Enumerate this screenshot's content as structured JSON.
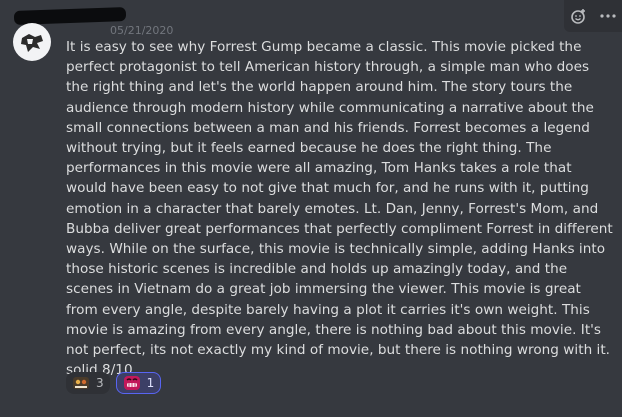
{
  "message": {
    "timestamp": "05/21/2020",
    "content": "It is easy to see why Forrest Gump became a classic. This movie picked the perfect protagonist to tell American history through, a simple man who does the right thing and let's the world happen around him. The story tours the audience through modern history while communicating a narrative about the small connections between a man and his friends. Forrest becomes a legend without trying, but it feels earned because he does the right thing. The performances in this movie were all amazing, Tom Hanks takes a role that would have been easy to not give that much for, and he runs with it, putting emotion in a character that barely emotes. Lt. Dan, Jenny, Forrest's Mom, and Bubba deliver great performances that perfectly compliment Forrest in different ways. While on the surface, this movie is technically simple, adding Hanks into those historic scenes is incredible and holds up amazingly today, and the scenes in Vietnam do a great job immersing the viewer. This movie is great from every angle, despite barely having a plot it carries it's own weight. This movie is amazing from every angle, there is nothing bad about this movie. It's not perfect, its not exactly my kind of movie, but there is nothing wrong with it. solid 8/10"
  },
  "reactions": [
    {
      "icon": "custom-emoji-icon",
      "count": "3"
    },
    {
      "icon": "grin-emoji-icon",
      "count": "1"
    }
  ],
  "toolbar": {
    "add_reaction_icon": "add-reaction-icon",
    "more_icon": "more-options-icon"
  },
  "colors": {
    "background": "#36393f",
    "text": "#dcddde",
    "muted": "#72767d",
    "reaction_active_border": "#5865f2"
  }
}
